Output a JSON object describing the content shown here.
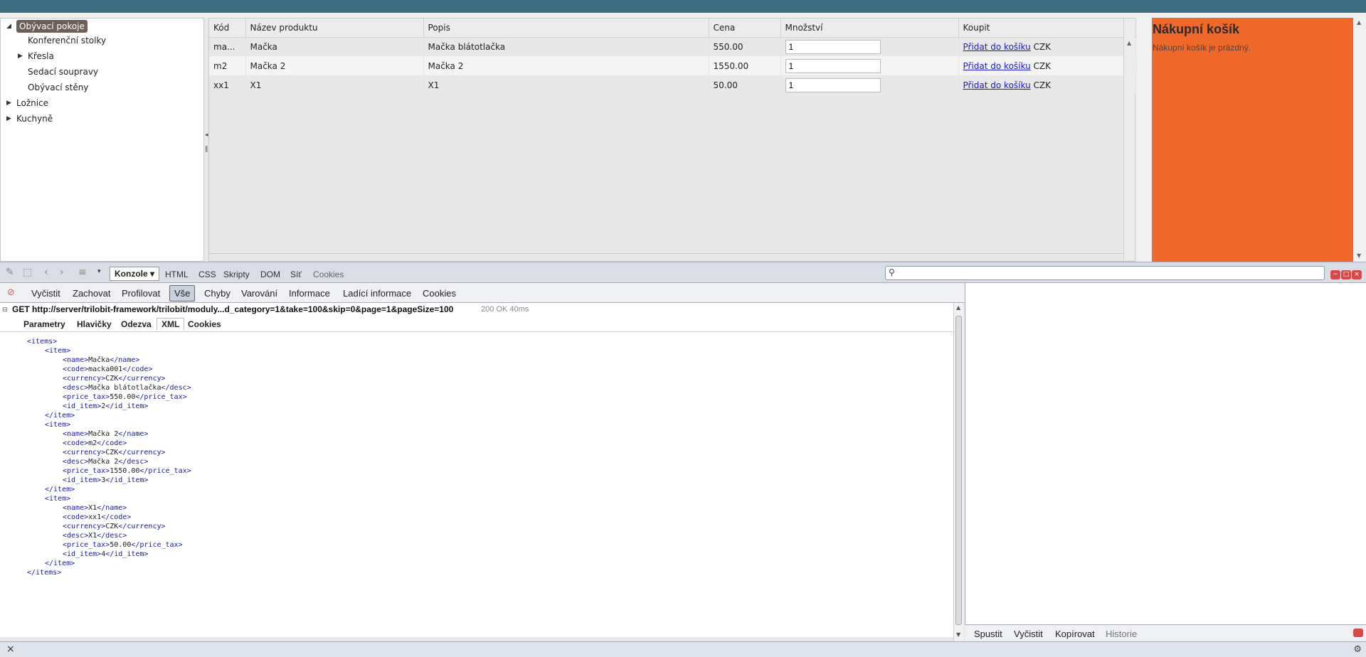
{
  "tree": {
    "items": [
      {
        "label": "Obývací pokoje",
        "arrow": "◢",
        "selected": true
      },
      {
        "label": "Konferenční stolky",
        "arrow": ""
      },
      {
        "label": "Křesla",
        "arrow": "▶"
      },
      {
        "label": "Sedací soupravy",
        "arrow": ""
      },
      {
        "label": "Obývací stěny",
        "arrow": ""
      },
      {
        "label": "Ložnice",
        "arrow": "▶"
      },
      {
        "label": "Kuchyně",
        "arrow": "▶"
      }
    ]
  },
  "grid": {
    "headers": [
      "Kód",
      "Název produktu",
      "Popis",
      "Cena",
      "Množství",
      "Koupit"
    ],
    "rows": [
      {
        "code": "ma...",
        "name": "Mačka",
        "desc": "Mačka blátotlačka",
        "price": "550.00",
        "qty": "1",
        "buy_link": "Přidat do košíku",
        "currency": "CZK"
      },
      {
        "code": "m2",
        "name": "Mačka 2",
        "desc": "Mačka 2",
        "price": "1550.00",
        "qty": "1",
        "buy_link": "Přidat do košíku",
        "currency": "CZK"
      },
      {
        "code": "xx1",
        "name": "X1",
        "desc": "X1",
        "price": "50.00",
        "qty": "1",
        "buy_link": "Přidat do košíku",
        "currency": "CZK"
      }
    ]
  },
  "cart": {
    "title": "Nákupní košík",
    "empty_text": "Nákupní košík je prázdný."
  },
  "firebug": {
    "panel_select": "Konzole",
    "tabs": [
      "HTML",
      "CSS",
      "Skripty",
      "DOM",
      "Síť",
      "Cookies"
    ],
    "console_buttons": [
      "Vyčistit",
      "Zachovat",
      "Profilovat",
      "Vše",
      "Chyby",
      "Varování",
      "Informace",
      "Ladící informace",
      "Cookies"
    ],
    "active_filter": "Vše",
    "request": {
      "url": "GET http://server/trilobit-framework/trilobit/moduly...d_category=1&take=100&skip=0&page=1&pageSize=100",
      "status": "200 OK 40ms"
    },
    "subtabs": [
      "Parametry",
      "Hlavičky",
      "Odezva",
      "XML",
      "Cookies"
    ],
    "active_subtab": "XML",
    "xml_lines": [
      {
        "indent": 0,
        "open": "<items>",
        "text": "",
        "close": ""
      },
      {
        "indent": 1,
        "open": "<item>",
        "text": "",
        "close": ""
      },
      {
        "indent": 2,
        "open": "<name>",
        "text": "Mačka",
        "close": "</name>"
      },
      {
        "indent": 2,
        "open": "<code>",
        "text": "macka001",
        "close": "</code>"
      },
      {
        "indent": 2,
        "open": "<currency>",
        "text": "CZK",
        "close": "</currency>"
      },
      {
        "indent": 2,
        "open": "<desc>",
        "text": "Mačka blátotlačka",
        "close": "</desc>"
      },
      {
        "indent": 2,
        "open": "<price_tax>",
        "text": "550.00",
        "close": "</price_tax>"
      },
      {
        "indent": 2,
        "open": "<id_item>",
        "text": "2",
        "close": "</id_item>"
      },
      {
        "indent": 1,
        "open": "</item>",
        "text": "",
        "close": ""
      },
      {
        "indent": 1,
        "open": "<item>",
        "text": "",
        "close": ""
      },
      {
        "indent": 2,
        "open": "<name>",
        "text": "Mačka 2",
        "close": "</name>"
      },
      {
        "indent": 2,
        "open": "<code>",
        "text": "m2",
        "close": "</code>"
      },
      {
        "indent": 2,
        "open": "<currency>",
        "text": "CZK",
        "close": "</currency>"
      },
      {
        "indent": 2,
        "open": "<desc>",
        "text": "Mačka 2",
        "close": "</desc>"
      },
      {
        "indent": 2,
        "open": "<price_tax>",
        "text": "1550.00",
        "close": "</price_tax>"
      },
      {
        "indent": 2,
        "open": "<id_item>",
        "text": "3",
        "close": "</id_item>"
      },
      {
        "indent": 1,
        "open": "</item>",
        "text": "",
        "close": ""
      },
      {
        "indent": 1,
        "open": "<item>",
        "text": "",
        "close": ""
      },
      {
        "indent": 2,
        "open": "<name>",
        "text": "X1",
        "close": "</name>"
      },
      {
        "indent": 2,
        "open": "<code>",
        "text": "xx1",
        "close": "</code>"
      },
      {
        "indent": 2,
        "open": "<currency>",
        "text": "CZK",
        "close": "</currency>"
      },
      {
        "indent": 2,
        "open": "<desc>",
        "text": "X1",
        "close": "</desc>"
      },
      {
        "indent": 2,
        "open": "<price_tax>",
        "text": "50.00",
        "close": "</price_tax>"
      },
      {
        "indent": 2,
        "open": "<id_item>",
        "text": "4",
        "close": "</id_item>"
      },
      {
        "indent": 1,
        "open": "</item>",
        "text": "",
        "close": ""
      },
      {
        "indent": 0,
        "open": "</items>",
        "text": "",
        "close": ""
      }
    ],
    "command_buttons": [
      "Spustit",
      "Vyčistit",
      "Kopírovat",
      "Historie"
    ],
    "statusbar_close": "×"
  }
}
